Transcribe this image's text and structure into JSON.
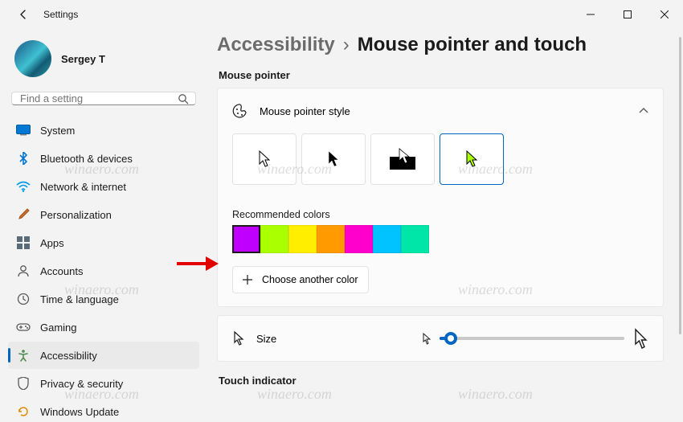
{
  "app": {
    "title": "Settings"
  },
  "profile": {
    "name": "Sergey T"
  },
  "search": {
    "placeholder": "Find a setting"
  },
  "nav": [
    {
      "label": "System"
    },
    {
      "label": "Bluetooth & devices"
    },
    {
      "label": "Network & internet"
    },
    {
      "label": "Personalization"
    },
    {
      "label": "Apps"
    },
    {
      "label": "Accounts"
    },
    {
      "label": "Time & language"
    },
    {
      "label": "Gaming"
    },
    {
      "label": "Accessibility"
    },
    {
      "label": "Privacy & security"
    },
    {
      "label": "Windows Update"
    }
  ],
  "crumbs": {
    "parent": "Accessibility",
    "current": "Mouse pointer and touch"
  },
  "sections": {
    "pointer": "Mouse pointer",
    "touch": "Touch indicator"
  },
  "style_card": {
    "title": "Mouse pointer style"
  },
  "colors": {
    "label": "Recommended colors",
    "swatches": [
      "#c000ff",
      "#aaff00",
      "#ffee00",
      "#ff9b00",
      "#ff00cc",
      "#00c3ff",
      "#00e6a8"
    ],
    "choose": "Choose another color"
  },
  "size_card": {
    "title": "Size"
  },
  "watermark": "winaero.com"
}
